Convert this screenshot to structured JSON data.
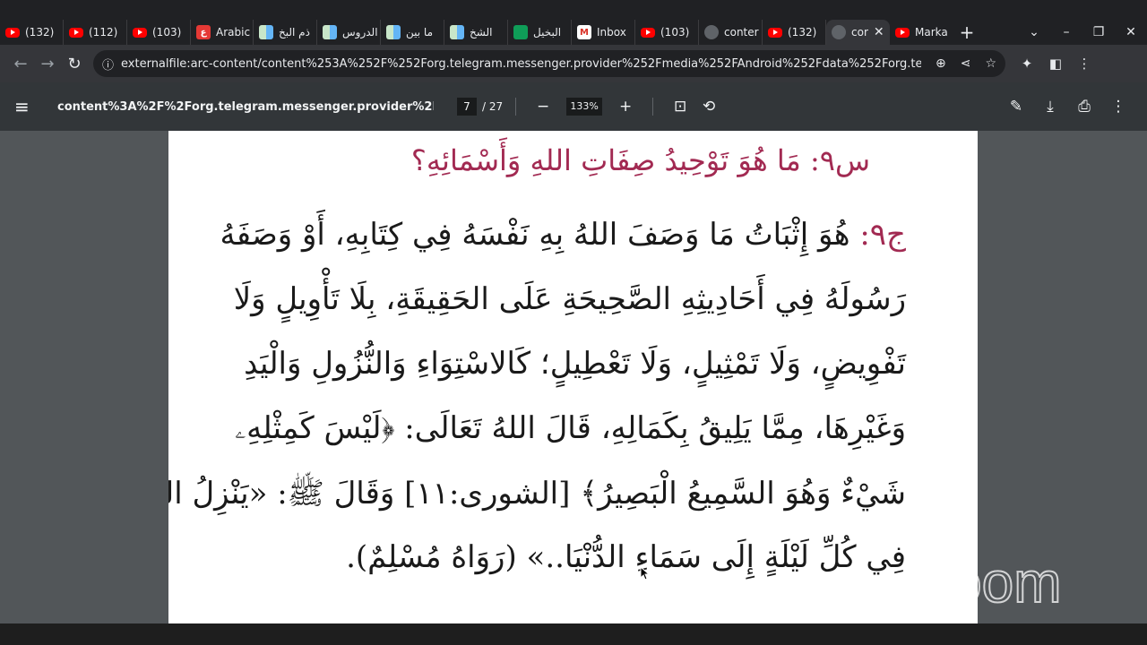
{
  "tabs": [
    {
      "icon": "youtube-icon",
      "label": "(132)"
    },
    {
      "icon": "youtube-icon",
      "label": "(112)"
    },
    {
      "icon": "youtube-icon",
      "label": "(103)"
    },
    {
      "icon": "arabic-site-icon",
      "label": "Arabic"
    },
    {
      "icon": "document-icon",
      "label": "ذم البخ"
    },
    {
      "icon": "document-icon",
      "label": "الدروس"
    },
    {
      "icon": "document-icon",
      "label": "ما بين"
    },
    {
      "icon": "document-icon",
      "label": "الشخ"
    },
    {
      "icon": "quran-site-icon",
      "label": "البخيل"
    },
    {
      "icon": "gmail-icon",
      "label": "Inbox"
    },
    {
      "icon": "youtube-icon",
      "label": "(103)"
    },
    {
      "icon": "globe-icon",
      "label": "conter"
    },
    {
      "icon": "youtube-icon",
      "label": "(132)"
    },
    {
      "icon": "globe-icon",
      "label": "cor",
      "active": true
    },
    {
      "icon": "youtube-icon",
      "label": "Marka"
    }
  ],
  "address_bar": {
    "url": "externalfile:arc-content/content%253A%252F%252Forg.telegram.messenger.provider%252Fmedia%252FAndroid%252Fdata%252Forg.telegram.messenger%252..."
  },
  "pdf_toolbar": {
    "title": "content%3A%2F%2Forg.telegram.messenger.provider%2Fmedia%2F...",
    "current_page": "7",
    "total_pages": "/ 27",
    "zoom": "133%"
  },
  "document": {
    "question": "س٩: مَا هُوَ تَوْحِيدُ صِفَاتِ اللهِ وَأَسْمَائِهِ؟",
    "answer_label": "ج٩:",
    "lines": [
      "هُوَ إِثْبَاتُ مَا وَصَفَ اللهُ بِهِ نَفْسَهُ فِي كِتَابِهِ، أَوْ وَصَفَهُ",
      "رَسُولَهُ فِي أَحَادِيثِهِ الصَّحِيحَةِ عَلَى الحَقِيقَةِ، بِلَا تَأْوِيلٍ وَلَا",
      "تَفْوِيضٍ، وَلَا تَمْثِيلٍ، وَلَا تَعْطِيلٍ؛ كَالاسْتِوَاءِ وَالنُّزُولِ وَالْيَدِ",
      "وَغَيْرِهَا، مِمَّا يَلِيقُ بِكَمَالِهِ، قَالَ اللهُ تَعَالَى: ﴿لَيْسَ كَمِثْلِهِۦ",
      "شَيْءٌ وَهُوَ السَّمِيعُ الْبَصِيرُ﴾ [الشورى:١١] وَقَالَ ﷺ: «يَنْزِلُ اللهُ",
      "فِي كُلِّ لَيْلَةٍ إِلَى سَمَاءِ الدُّنْيَا..» (رَوَاهُ مُسْلِمٌ)."
    ]
  },
  "watermark": "zoom"
}
